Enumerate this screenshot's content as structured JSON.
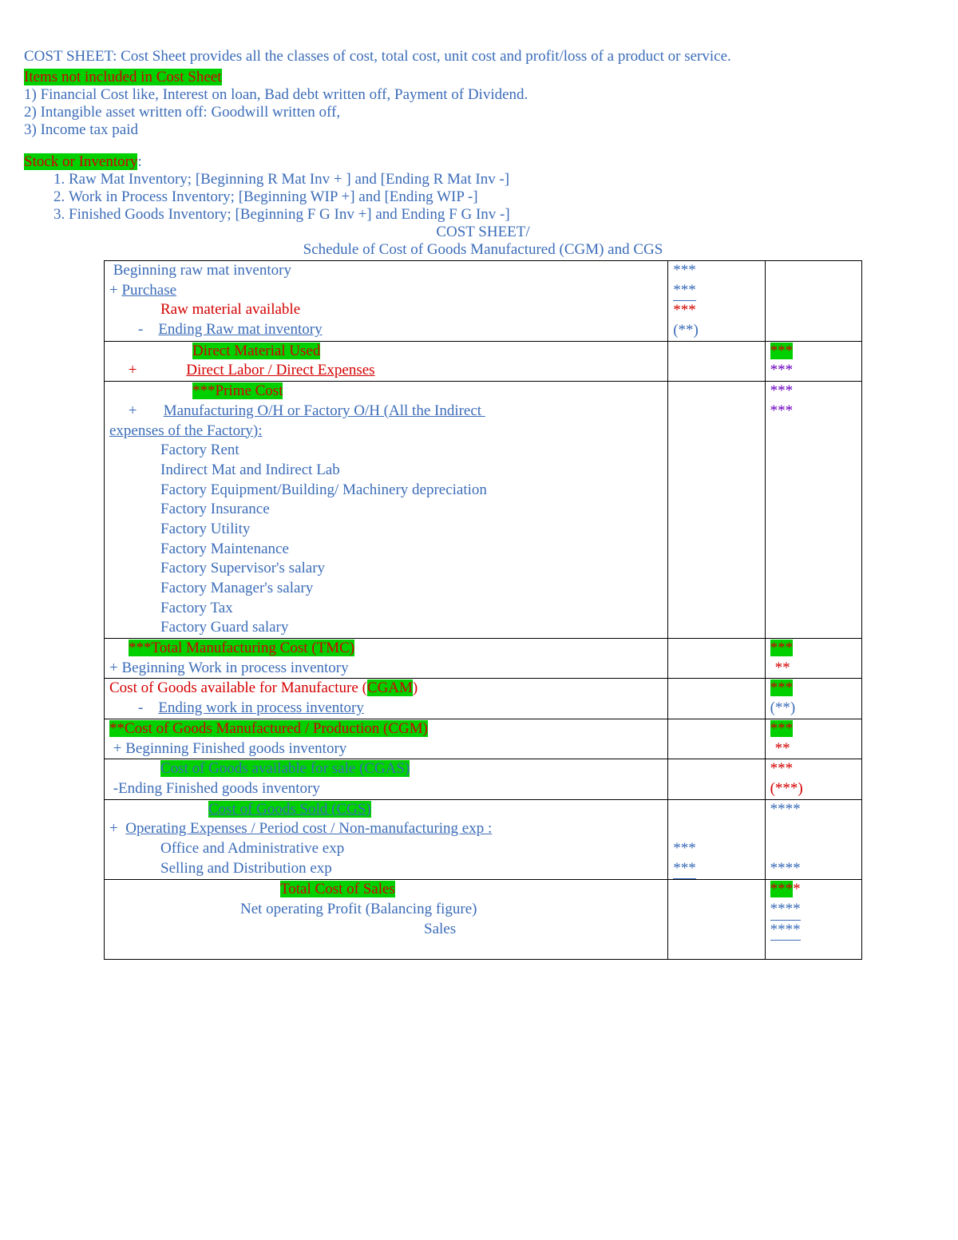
{
  "intro": {
    "title": " COST SHEET: Cost Sheet provides all the classes of cost, total cost, unit cost and profit/loss of a product or service.",
    "excluded_heading": "Items not included in Cost Sheet ",
    "excluded": [
      "1) Financial Cost like,  Interest on loan, Bad debt written off, Payment of Dividend.",
      "2) Intangible asset written off: Goodwill written off,",
      "3) Income tax paid"
    ],
    "stock_heading": "Stock or Inventory",
    "stock_colon": ":",
    "stock_items": [
      "Raw Mat Inventory; [Beginning R Mat Inv + ] and [Ending R Mat Inv -]",
      "Work in Process Inventory; [Beginning WIP +] and [Ending WIP -]",
      "Finished Goods Inventory; [Beginning F G Inv +] and Ending F G Inv -]"
    ],
    "schedule_heading1": "COST SHEET/",
    "schedule_heading2": "Schedule of Cost of Goods Manufactured (CGM) and CGS"
  },
  "r1": {
    "l1": " Beginning raw mat inventory",
    "l2_sign": "+ ",
    "l2": "Purchase",
    "l3": "Raw material available",
    "l4_sign": "-    ",
    "l4": "Ending Raw mat inventory",
    "a1": "***",
    "a2": "***",
    "a3": "***",
    "a4": "(**)"
  },
  "r2": {
    "l1": "Direct Material Used",
    "l2_sign": "     +             ",
    "l2": "Direct Labor / Direct Expenses",
    "b1": "***",
    "b2": "***"
  },
  "r3": {
    "l1": "***Prime Cost",
    "l2_sign": "     +       ",
    "l2": "Manufacturing O/H or Factory O/H (All the Indirect ",
    "l2b": "expenses of the Factory):",
    "items": [
      "Factory Rent",
      "Indirect Mat and Indirect Lab",
      "Factory Equipment/Building/ Machinery depreciation",
      "Factory Insurance",
      "Factory Utility",
      "Factory Maintenance",
      "Factory Supervisor's salary",
      "Factory Manager's salary",
      "Factory Tax",
      "Factory Guard salary"
    ],
    "b1": "***",
    "b2": "***"
  },
  "r4": {
    "l1": "***Total Manufacturing Cost (TMC)",
    "l2": "+ Beginning Work in process inventory",
    "b1": "***",
    "b2": "**"
  },
  "r5": {
    "l1a": "Cost of Goods available for Manufacture (",
    "l1b": "CGAM",
    "l1c": ")",
    "l2_sign": "-    ",
    "l2": "Ending work in process inventory",
    "b1": "***",
    "b2": "(**)"
  },
  "r6": {
    "l1": "**Cost of Goods Manufactured / Production (CGM)",
    "l2": " + Beginning Finished goods inventory",
    "b1": "***",
    "b2": "**"
  },
  "r7": {
    "l1": "Cost of Goods available for sale (CGAS)",
    "l2": " -Ending Finished goods inventory",
    "b1": "***",
    "b2": "(***)"
  },
  "r8": {
    "l1": "Cost of Goods Sold (CGS)",
    "l2_sign": "+  ",
    "l2": "Operating Expenses / Period cost / Non-manufacturing exp :",
    "l3": "Office and Administrative exp",
    "l4": "Selling and Distribution exp",
    "b1": "****",
    "a3": "***",
    "a4": "***",
    "b4": "****"
  },
  "r9": {
    "l1": "Total Cost of Sales",
    "l2": "Net operating Profit (Balancing figure)",
    "l3": "Sales",
    "b1a": "***",
    "b1b": "*",
    "b2": "****",
    "b3": "****"
  }
}
